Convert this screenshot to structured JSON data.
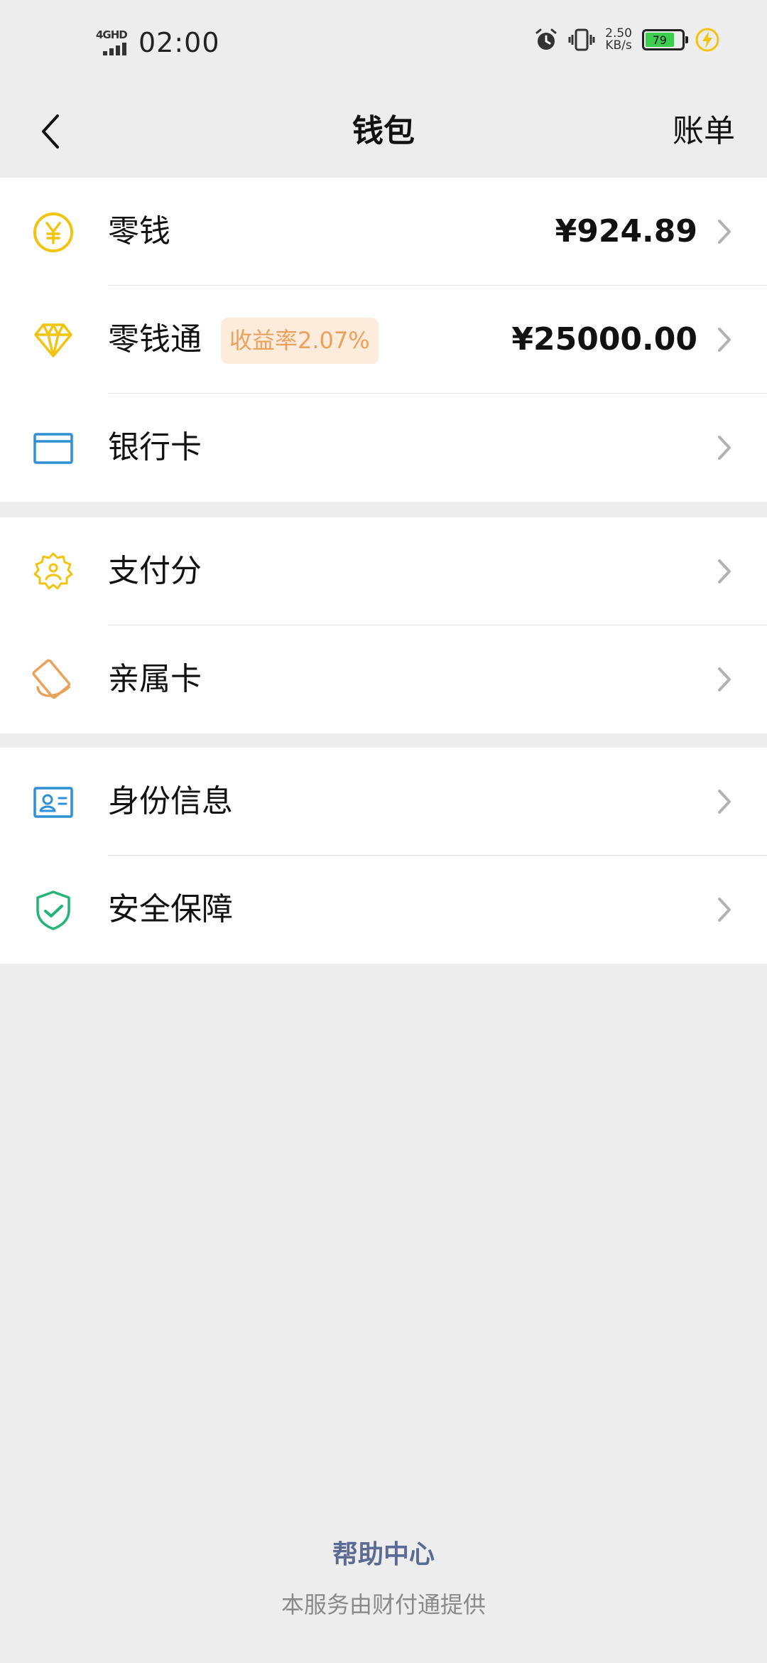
{
  "status_bar": {
    "network": "4GHD",
    "time": "02:00",
    "speed_value": "2.50",
    "speed_unit": "KB/s",
    "battery": "79"
  },
  "header": {
    "title": "钱包",
    "bill_label": "账单"
  },
  "groups": [
    {
      "items": [
        {
          "label": "零钱",
          "value": "¥924.89",
          "icon": "yuan-coin-icon"
        },
        {
          "label": "零钱通",
          "badge": "收益率2.07%",
          "value": "¥25000.00",
          "icon": "diamond-icon"
        },
        {
          "label": "银行卡",
          "icon": "bank-card-icon"
        }
      ]
    },
    {
      "items": [
        {
          "label": "支付分",
          "icon": "pay-score-badge-icon"
        },
        {
          "label": "亲属卡",
          "icon": "family-card-icon"
        }
      ]
    },
    {
      "items": [
        {
          "label": "身份信息",
          "icon": "id-card-icon"
        },
        {
          "label": "安全保障",
          "icon": "shield-check-icon"
        }
      ]
    }
  ],
  "footer": {
    "help_center": "帮助中心",
    "provider_note": "本服务由财付通提供"
  },
  "colors": {
    "background": "#ededed",
    "yellow_icon": "#f1c40f",
    "blue_icon": "#2f8fd6",
    "orange_icon": "#e9a25c",
    "green_icon": "#23b573",
    "badge_bg": "#fdebdc",
    "help_link": "#5b6b94"
  }
}
